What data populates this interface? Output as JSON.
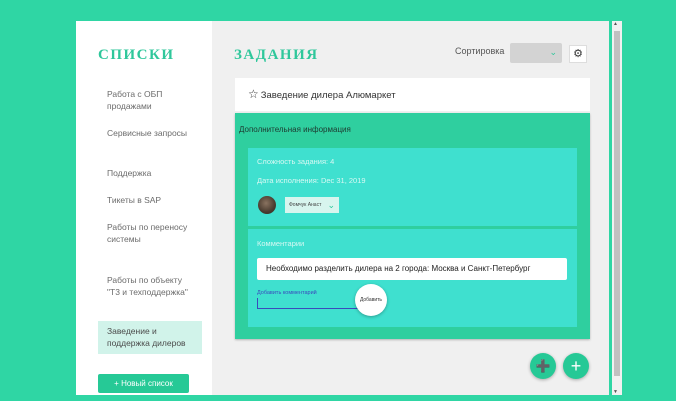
{
  "sidebar": {
    "title": "СПИСКИ",
    "items": [
      {
        "label": "Работа с ОБП продажами"
      },
      {
        "label": "Сервисные запросы"
      },
      {
        "label": "Поддержка"
      },
      {
        "label": "Тикеты в SAP"
      },
      {
        "label": "Работы по переносу системы"
      },
      {
        "label": "Работы по объекту \"Т3 и техподдержка\""
      },
      {
        "label": "Заведение и поддержка дилеров"
      }
    ],
    "new_list_label": "+ Новый список"
  },
  "main": {
    "title": "ЗАДАНИЯ",
    "sort_label": "Сортировка",
    "sort_icon": "chevron-down-icon",
    "settings_icon": "gear-icon"
  },
  "task": {
    "title": "Заведение дилера Алюмаркет",
    "additional_info_label": "Дополнительная информация",
    "complexity": "Сложность задания: 4",
    "due_date": "Дата исполнения: Dec 31, 2019",
    "assignee": "Фомчук Анаст",
    "comments_label": "Комментарии",
    "comment_text": "Необходимо разделить дилера на 2 города: Москва и Санкт-Петербург",
    "add_comment_placeholder": "Добавить комментарий",
    "add_button_label": "Добавить"
  },
  "fabs": {
    "add_user_icon": "add-user-icon",
    "add_icon": "plus-icon"
  },
  "colors": {
    "background": "#2fd6a4",
    "accent": "#2fc79b",
    "panel": "#2fcf9f",
    "box": "#3fe0cf"
  }
}
